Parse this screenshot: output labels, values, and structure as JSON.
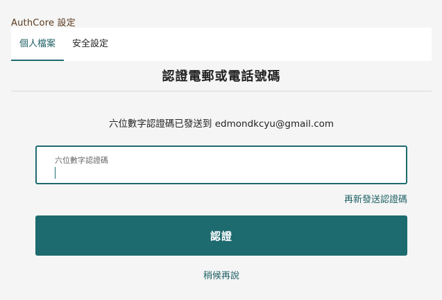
{
  "app": {
    "title": "AuthCore 設定"
  },
  "tabs": [
    {
      "label": "個人檔案",
      "active": true
    },
    {
      "label": "安全設定",
      "active": false
    }
  ],
  "verify": {
    "heading": "認證電郵或電話號碼",
    "sent_message": "六位數字認證碼已發送到 edmondkcyu@gmail.com",
    "code_field": {
      "label": "六位數字認證碼",
      "value": ""
    },
    "resend_label": "再新發送認證碼",
    "submit_label": "認證",
    "later_label": "稍候再說"
  },
  "colors": {
    "accent": "#1d6a6f",
    "background": "#f5f5f5",
    "title_text": "#5a3a1e"
  }
}
